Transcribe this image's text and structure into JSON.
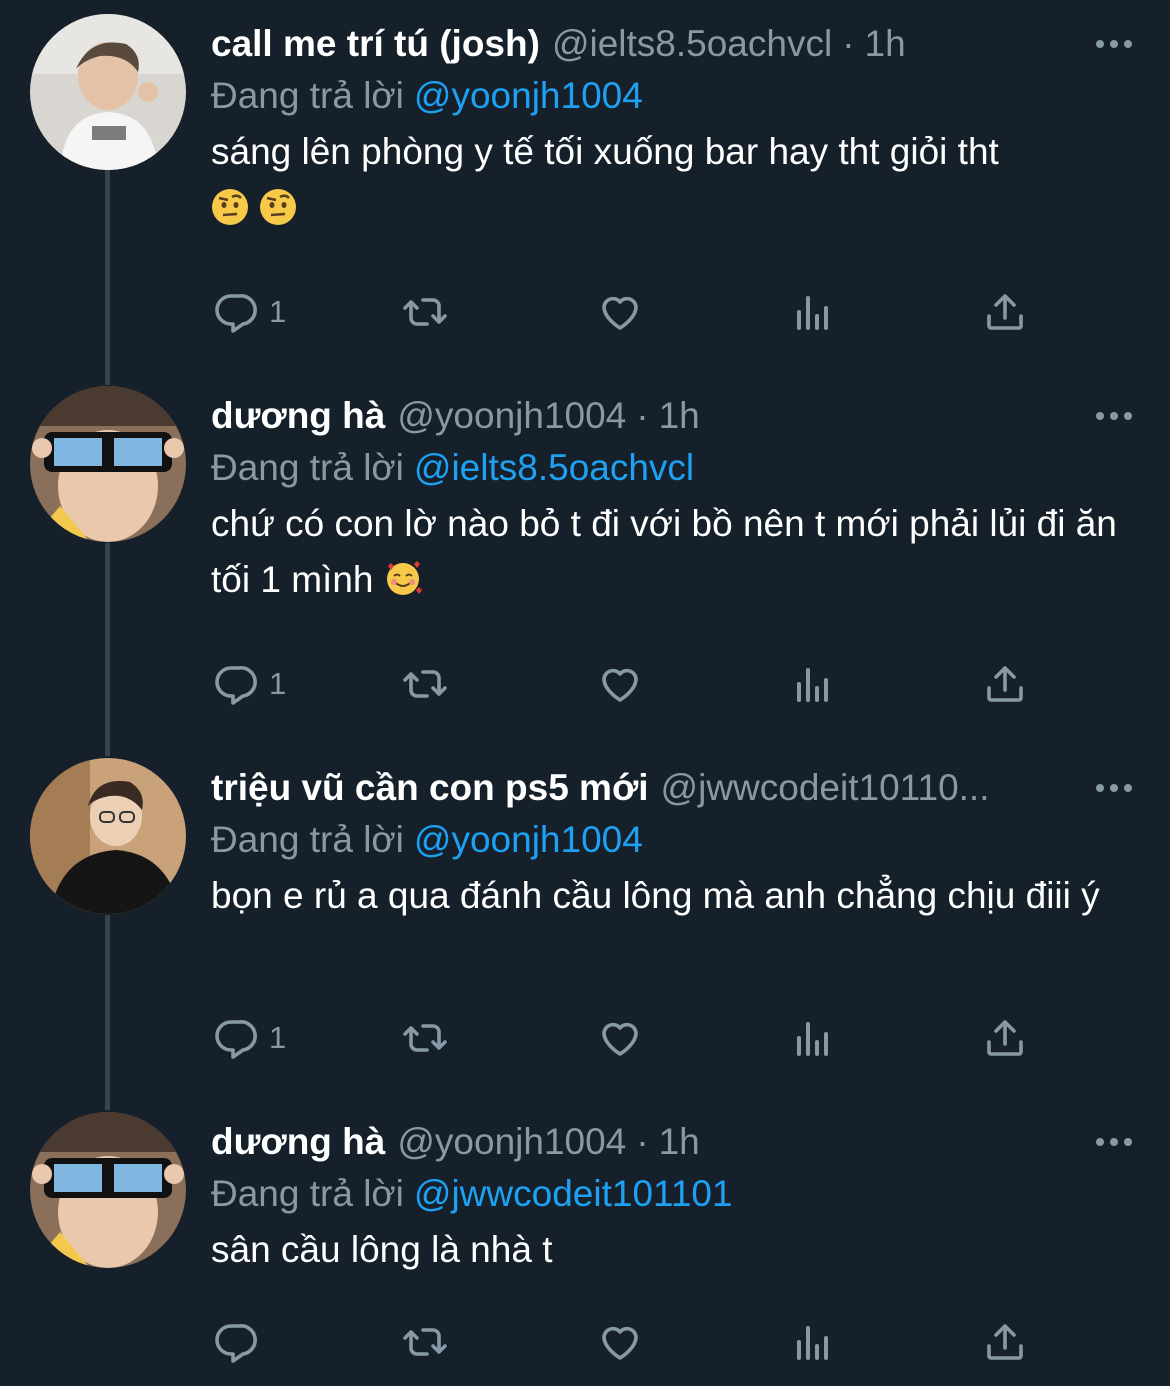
{
  "theme": {
    "background": "#15202b",
    "text": "#ffffff",
    "muted": "#8899a6",
    "link": "#1da1f2",
    "thread_line": "#38444d"
  },
  "tweets": [
    {
      "name": "call me trí tú (josh)",
      "handle": "@ielts8.5oachvcl",
      "time": "1h",
      "replying_label": "Đang trả lời",
      "replying_to": "@yoonjh1004",
      "text": "sáng lên phòng y tế tối xuống bar hay tht giỏi tht",
      "emojis": [
        "face-with-raised-eyebrow",
        "face-with-raised-eyebrow"
      ],
      "reply_count": "1"
    },
    {
      "name": "dương hà",
      "handle": "@yoonjh1004",
      "time": "1h",
      "replying_label": "Đang trả lời",
      "replying_to": "@ielts8.5oachvcl",
      "text": "chứ có con lờ nào bỏ t đi với bồ nên t mới phải lủi đi ăn tối 1 mình",
      "emojis": [
        "smiling-face-with-hearts"
      ],
      "reply_count": "1"
    },
    {
      "name": "triệu vũ cần con ps5 mới",
      "handle": "@jwwcodeit10110...",
      "time": "",
      "replying_label": "Đang trả lời",
      "replying_to": "@yoonjh1004",
      "text": "bọn e rủ a qua đánh cầu lông mà anh chẳng chịu điii ý",
      "emojis": [],
      "reply_count": "1"
    },
    {
      "name": "dương hà",
      "handle": "@yoonjh1004",
      "time": "1h",
      "replying_label": "Đang trả lời",
      "replying_to": "@jwwcodeit101101",
      "text": "sân cầu lông là nhà t",
      "emojis": [],
      "reply_count": ""
    }
  ],
  "icons": {
    "more": "more-horizontal-icon",
    "reply": "reply-bubble-icon",
    "retweet": "retweet-icon",
    "like": "heart-icon",
    "analytics": "analytics-bars-icon",
    "share": "share-upload-icon"
  }
}
